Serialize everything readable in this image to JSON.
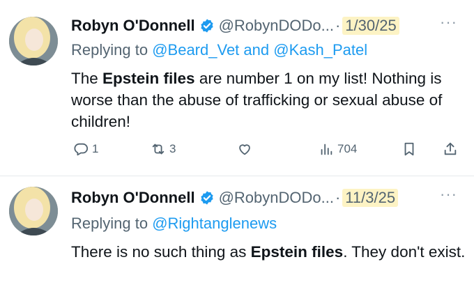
{
  "tweets": [
    {
      "author_name": "Robyn O'Donnell",
      "handle": "@RobynDODo...",
      "separator": "·",
      "date": "1/30/25",
      "more": "···",
      "replying_prefix": "Replying to",
      "replying_to_1": "@Beard_Vet",
      "replying_joiner": "and",
      "replying_to_2": "@Kash_Patel",
      "text_1": "The ",
      "text_bold": "Epstein files",
      "text_2": " are number 1 on my list! Nothing is worse than the abuse of trafficking or sexual abuse of children!",
      "actions": {
        "replies": "1",
        "reposts": "3",
        "views": "704"
      }
    },
    {
      "author_name": "Robyn O'Donnell",
      "handle": "@RobynDODo...",
      "separator": "·",
      "date": "11/3/25",
      "more": "···",
      "replying_prefix": "Replying to",
      "replying_to_1": "@Rightanglenews",
      "text_1": "There is no such thing as ",
      "text_bold": "Epstein files",
      "text_2": ". They don't exist."
    }
  ],
  "colors": {
    "verified": "#1d9bf0",
    "link": "#1d9bf0",
    "highlight": "#fdf3c4",
    "muted": "#536471"
  }
}
